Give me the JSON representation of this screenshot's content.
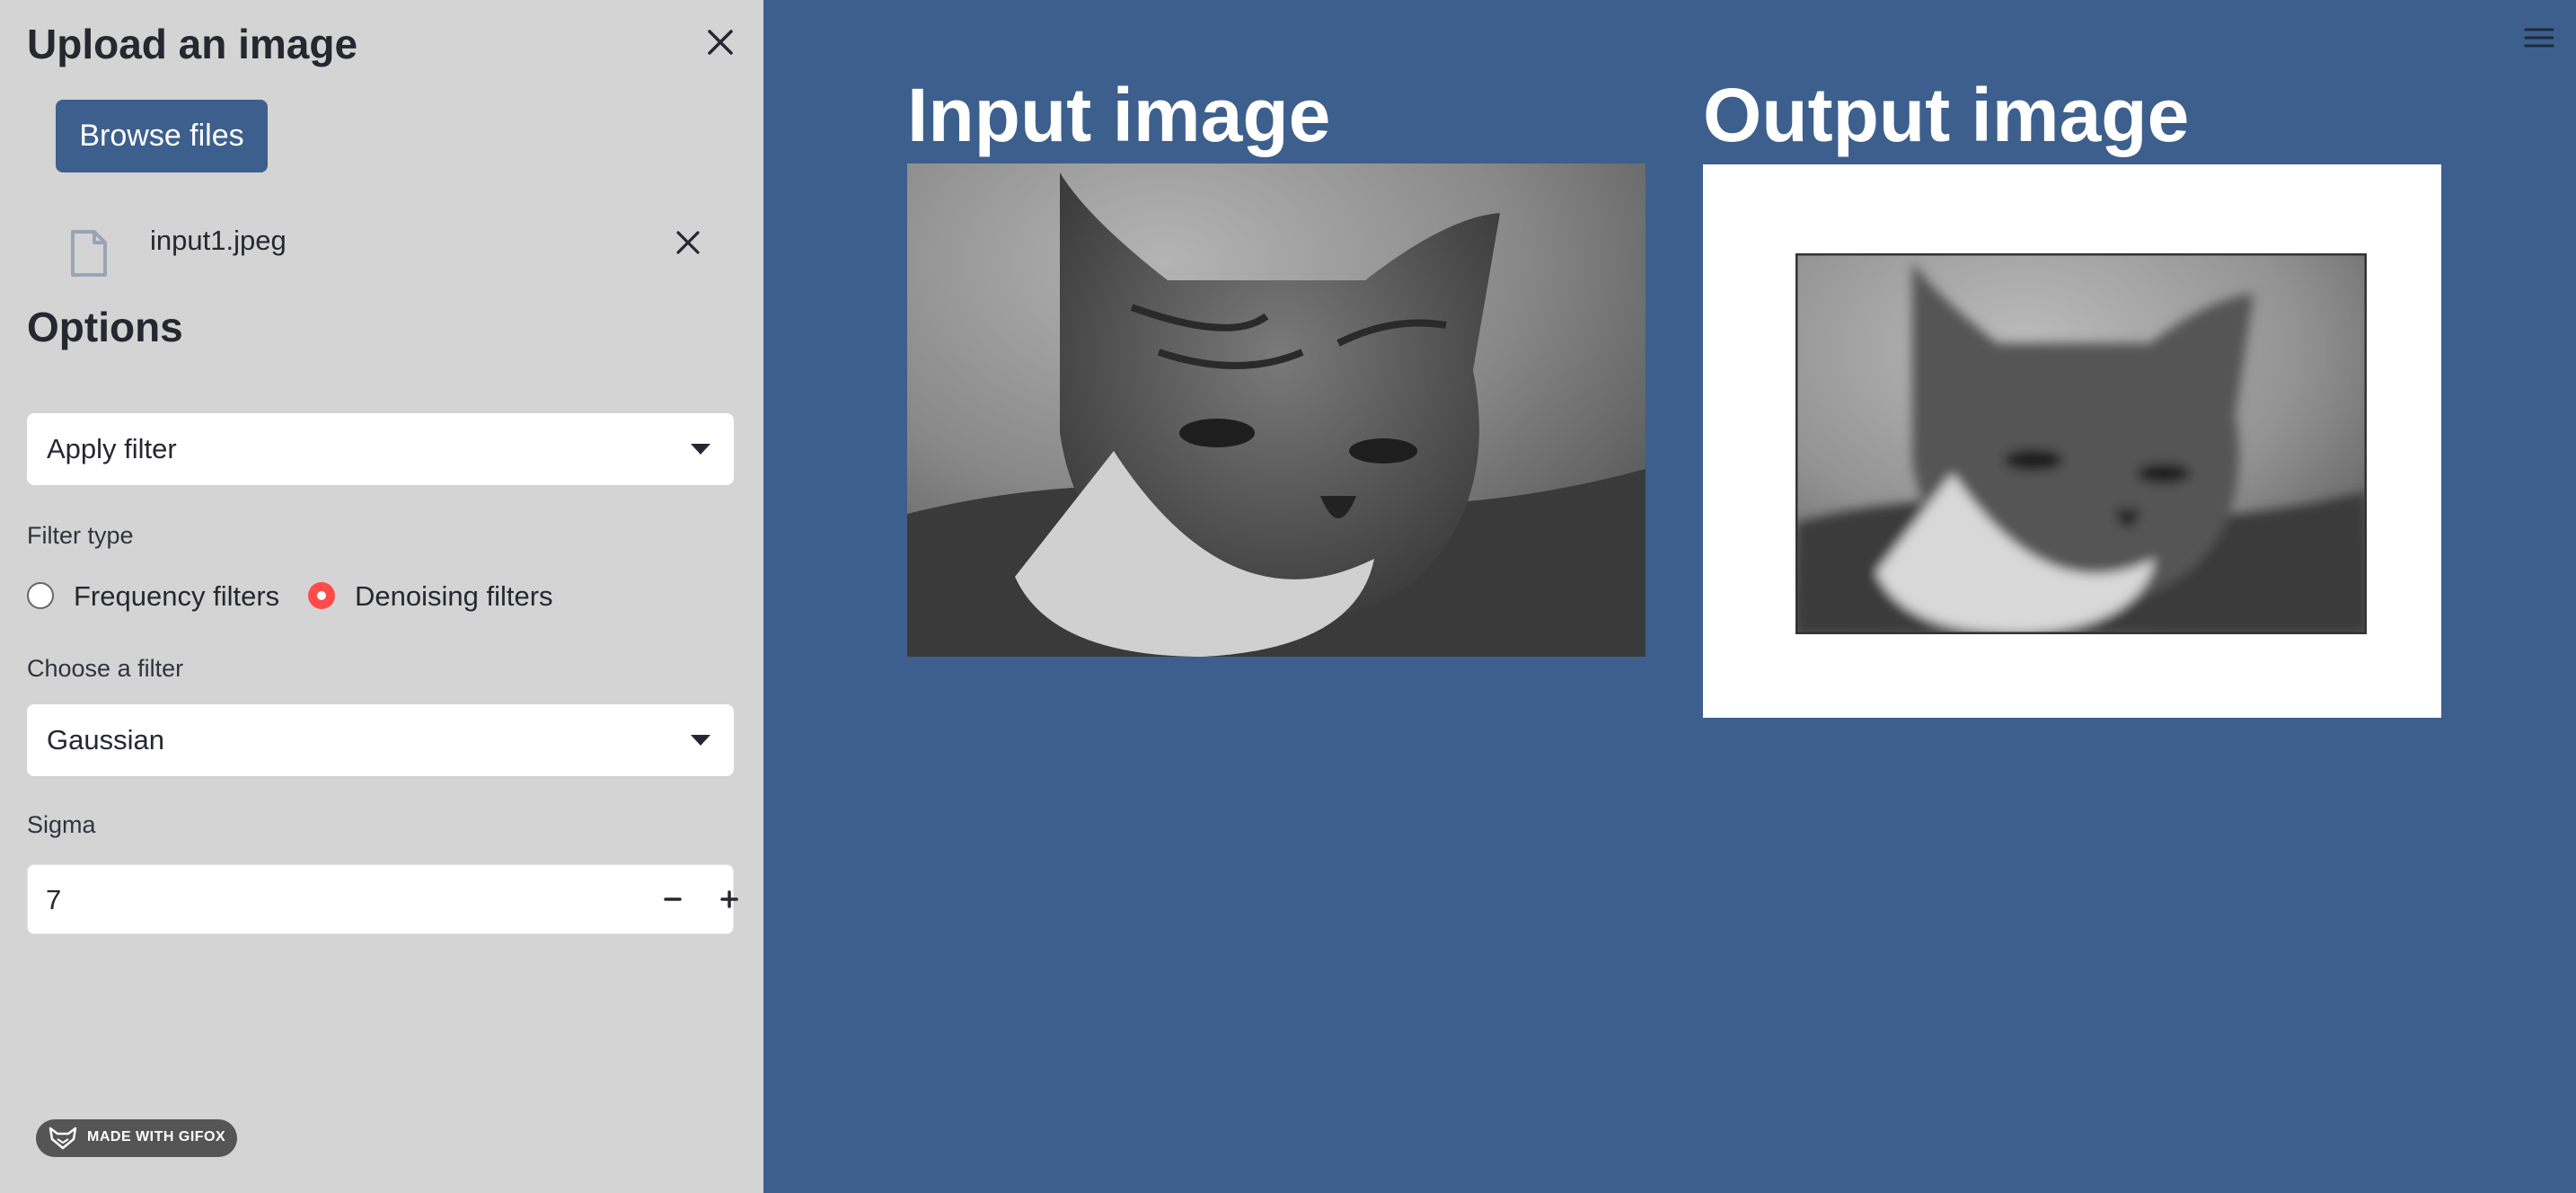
{
  "sidebar": {
    "upload_title": "Upload an image",
    "browse_label": "Browse files",
    "file_name": "input1.jpeg",
    "options_title": "Options",
    "action_select": "Apply filter",
    "filter_type_label": "Filter type",
    "radio_options": [
      "Frequency filters",
      "Denoising filters"
    ],
    "radio_selected": "Denoising filters",
    "choose_filter_label": "Choose a filter",
    "filter_select": "Gaussian",
    "sigma_label": "Sigma",
    "sigma_value": "7",
    "badge": "MADE WITH GIFOX"
  },
  "main": {
    "input_title": "Input image",
    "output_title": "Output image"
  },
  "colors": {
    "sidebar_bg": "#d4d4d4",
    "main_bg": "#3d5f8d",
    "button_bg": "#3d5f8d",
    "radio_selected": "#ff4b4b"
  },
  "icons": [
    "close-icon",
    "file-icon",
    "chevron-down-icon",
    "minus-icon",
    "plus-icon",
    "menu-icon",
    "fox-icon"
  ]
}
